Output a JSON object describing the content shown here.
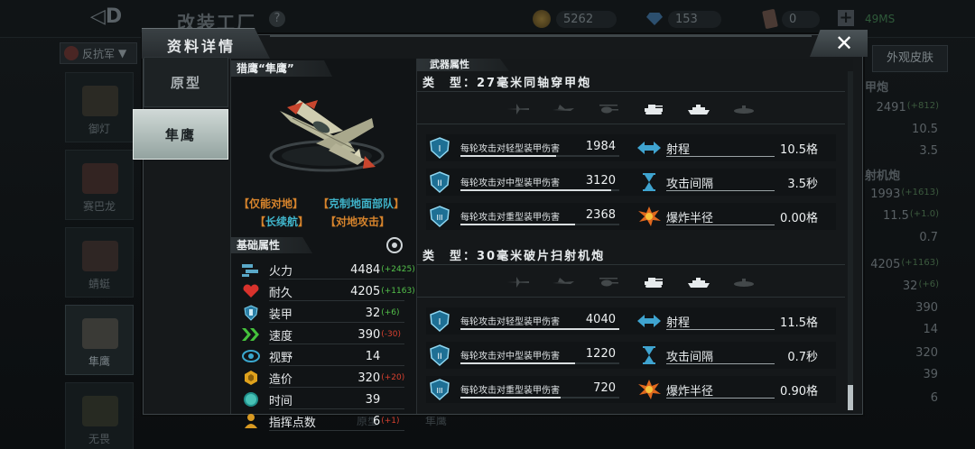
{
  "background": {
    "title": "改装工厂",
    "help": "?",
    "resources": {
      "gold": "5262",
      "gems": "153",
      "cards": "0",
      "ping": "49MS"
    },
    "faction": "反抗军",
    "units": [
      {
        "name": "御灯"
      },
      {
        "name": "赛巴龙"
      },
      {
        "name": "蜻蜓"
      },
      {
        "name": "隼鹰"
      },
      {
        "name": "无畏"
      }
    ],
    "skin_tab": "外观皮肤",
    "right_headers": [
      "甲炮",
      "射机炮"
    ],
    "right_values": [
      {
        "v": "2491",
        "b": "(+812)"
      },
      {
        "v": "10.5",
        "b": ""
      },
      {
        "v": "3.5",
        "b": ""
      },
      {
        "v": "1993",
        "b": "(+1613)"
      },
      {
        "v": "11.5",
        "b": "(+1.0)"
      },
      {
        "v": "0.7",
        "b": ""
      },
      {
        "v": "4205",
        "b": "(+1163)"
      },
      {
        "v": "32",
        "b": "(+6)"
      },
      {
        "v": "390",
        "b": ""
      },
      {
        "v": "14",
        "b": ""
      },
      {
        "v": "320",
        "b": ""
      },
      {
        "v": "39",
        "b": ""
      },
      {
        "v": "6",
        "b": ""
      }
    ],
    "bottom_tabs": [
      "原型",
      "隼鹰"
    ]
  },
  "modal": {
    "title": "资料详情",
    "close": "✕",
    "tabs": [
      {
        "label": "原型"
      },
      {
        "label": "隼鹰"
      }
    ],
    "unit": {
      "name": "猎鹰“隼鹰”",
      "tags": [
        {
          "text": "仅能对地",
          "color": "orange"
        },
        {
          "text": "克制地面部队",
          "color": "cyan"
        },
        {
          "text": "长续航",
          "color": "cyan"
        },
        {
          "text": "对地攻击",
          "color": "orange"
        }
      ],
      "attr_title": "基础属性",
      "attrs": [
        {
          "name": "火力",
          "value": "4484",
          "bonus": "(+2425)",
          "sign": "pos",
          "icon": "firepower-icon"
        },
        {
          "name": "耐久",
          "value": "4205",
          "bonus": "(+1163)",
          "sign": "pos",
          "icon": "heart-icon"
        },
        {
          "name": "装甲",
          "value": "32",
          "bonus": "(+6)",
          "sign": "pos",
          "icon": "armor-icon"
        },
        {
          "name": "速度",
          "value": "390",
          "bonus": "(-30)",
          "sign": "neg",
          "icon": "speed-icon"
        },
        {
          "name": "视野",
          "value": "14",
          "bonus": "",
          "sign": "pos",
          "icon": "eye-icon"
        },
        {
          "name": "造价",
          "value": "320",
          "bonus": "(+20)",
          "sign": "neg",
          "icon": "cost-icon"
        },
        {
          "name": "时间",
          "value": "39",
          "bonus": "",
          "sign": "pos",
          "icon": "time-icon"
        },
        {
          "name": "指挥点数",
          "value": "6",
          "bonus": "(+1)",
          "sign": "neg",
          "icon": "command-icon"
        }
      ]
    },
    "weapons_title": "武器属性",
    "weapons": [
      {
        "type": "类　型：27毫米同轴穿甲炮",
        "targets": [
          {
            "icon": "aircraft-icon",
            "on": false
          },
          {
            "icon": "jet-icon",
            "on": false
          },
          {
            "icon": "helicopter-icon",
            "on": false
          },
          {
            "icon": "tank-icon",
            "on": true
          },
          {
            "icon": "ship-icon",
            "on": true
          },
          {
            "icon": "submarine-icon",
            "on": false
          }
        ],
        "rows": [
          {
            "tier": "I",
            "label": "每轮攻击对轻型装甲伤害",
            "value": "1984",
            "fill": 0.6,
            "stat_icon": "range-icon",
            "stat_label": "射程",
            "stat_value": "10.5格"
          },
          {
            "tier": "II",
            "label": "每轮攻击对中型装甲伤害",
            "value": "3120",
            "fill": 0.95,
            "stat_icon": "hourglass-icon",
            "stat_label": "攻击间隔",
            "stat_value": "3.5秒"
          },
          {
            "tier": "III",
            "label": "每轮攻击对重型装甲伤害",
            "value": "2368",
            "fill": 0.72,
            "stat_icon": "explosion-icon",
            "stat_label": "爆炸半径",
            "stat_value": "0.00格"
          }
        ]
      },
      {
        "type": "类　型：30毫米破片扫射机炮",
        "targets": [
          {
            "icon": "aircraft-icon",
            "on": false
          },
          {
            "icon": "jet-icon",
            "on": false
          },
          {
            "icon": "helicopter-icon",
            "on": false
          },
          {
            "icon": "tank-icon",
            "on": true
          },
          {
            "icon": "ship-icon",
            "on": true
          },
          {
            "icon": "submarine-icon",
            "on": false
          }
        ],
        "rows": [
          {
            "tier": "I",
            "label": "每轮攻击对轻型装甲伤害",
            "value": "4040",
            "fill": 1.0,
            "stat_icon": "range-icon",
            "stat_label": "射程",
            "stat_value": "11.5格"
          },
          {
            "tier": "II",
            "label": "每轮攻击对中型装甲伤害",
            "value": "1220",
            "fill": 0.72,
            "stat_icon": "hourglass-icon",
            "stat_label": "攻击间隔",
            "stat_value": "0.7秒"
          },
          {
            "tier": "III",
            "label": "每轮攻击对重型装甲伤害",
            "value": "720",
            "fill": 0.63,
            "stat_icon": "explosion-icon",
            "stat_label": "爆炸半径",
            "stat_value": "0.90格"
          }
        ]
      }
    ]
  }
}
